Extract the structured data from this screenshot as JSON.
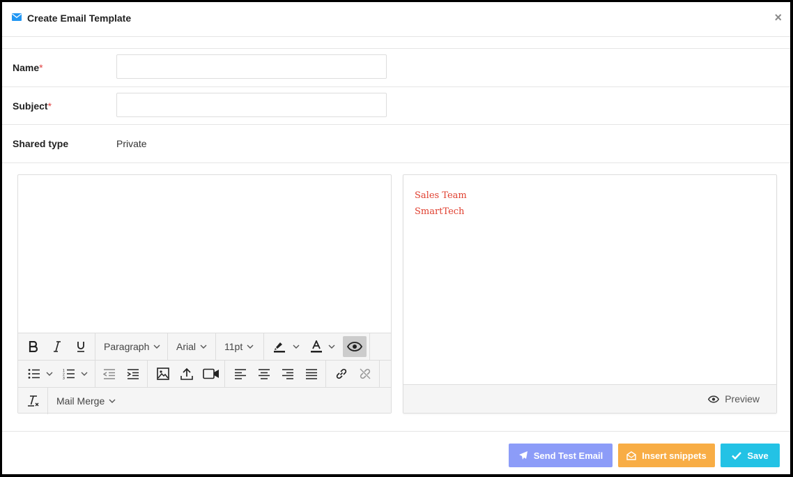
{
  "modal": {
    "title": "Create Email Template",
    "close": "×"
  },
  "form": {
    "name": {
      "label": "Name",
      "required": "*",
      "value": "",
      "placeholder": ""
    },
    "subject": {
      "label": "Subject",
      "required": "*",
      "value": "",
      "placeholder": ""
    },
    "shared_type": {
      "label": "Shared type",
      "value": "Private"
    }
  },
  "toolbar": {
    "block_format": "Paragraph",
    "font_family": "Arial",
    "font_size": "11pt",
    "mail_merge": "Mail Merge",
    "icons": [
      "bold-icon",
      "italic-icon",
      "underline-icon",
      "highlight-icon",
      "text-color-icon",
      "eye-icon",
      "bullet-list-icon",
      "numbered-list-icon",
      "outdent-icon",
      "indent-icon",
      "image-icon",
      "upload-icon",
      "video-icon",
      "align-left-icon",
      "align-center-icon",
      "align-right-icon",
      "align-justify-icon",
      "link-icon",
      "unlink-icon",
      "clear-format-icon"
    ]
  },
  "signature": {
    "line1": "Sales Team",
    "line2": "SmartTech"
  },
  "preview": {
    "label": "Preview"
  },
  "buttons": {
    "send_test": "Send Test Email",
    "insert_snippets": "Insert snippets",
    "save": "Save"
  },
  "colors": {
    "send_test": "#8c9cf8",
    "insert_snippets": "#f8ad45",
    "save": "#23c2e5",
    "accent": "#2196f3",
    "signature": "#e04030"
  }
}
